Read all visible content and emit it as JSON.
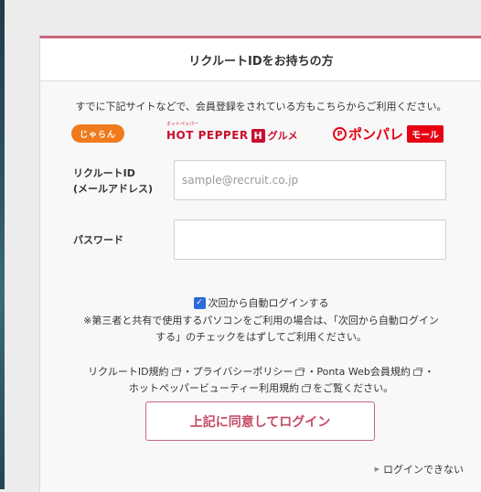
{
  "header": {
    "title": "リクルートIDをお持ちの方"
  },
  "intro": {
    "text": "すでに下記サイトなどで、会員登録をされている方もこちらからご利用ください。"
  },
  "logos": {
    "jalan": "じゃらん",
    "hotpepper_small": "ホットペッパー",
    "hotpepper_main": "HOT PEPPER",
    "hotpepper_box": "H",
    "hotpepper_gourmet": "グルメ",
    "ponpare_circle": "P",
    "ponpare_text": "ポンパレ",
    "ponpare_box": "モール"
  },
  "form": {
    "id_label_line1": "リクルートID",
    "id_label_line2": "(メールアドレス)",
    "id_placeholder": "sample@recruit.co.jp",
    "password_label": "パスワード",
    "password_placeholder": ""
  },
  "auto_login": {
    "checked": true,
    "label": "次回から自動ログインする"
  },
  "note": {
    "line1": "※第三者と共有で使用するパソコンをご利用の場合は、「次回から自動ログイン",
    "line2": "する」のチェックをはずしてご利用ください。"
  },
  "terms": {
    "link1": "リクルートID規約",
    "link2": "プライバシーポリシー",
    "link3": "Ponta Web会員規約",
    "link4": "ホットペッパービューティー利用規約",
    "separator": "・",
    "suffix": "をご覧ください。"
  },
  "buttons": {
    "login": "上記に同意してログイン"
  },
  "links": {
    "cannot_login": "ログインできない"
  },
  "colors": {
    "accent": "#c8687c",
    "button_text": "#c44a66",
    "hotpepper_red": "#c8102e",
    "ponpare_red": "#e60012",
    "jalan_orange": "#f07a1c"
  }
}
